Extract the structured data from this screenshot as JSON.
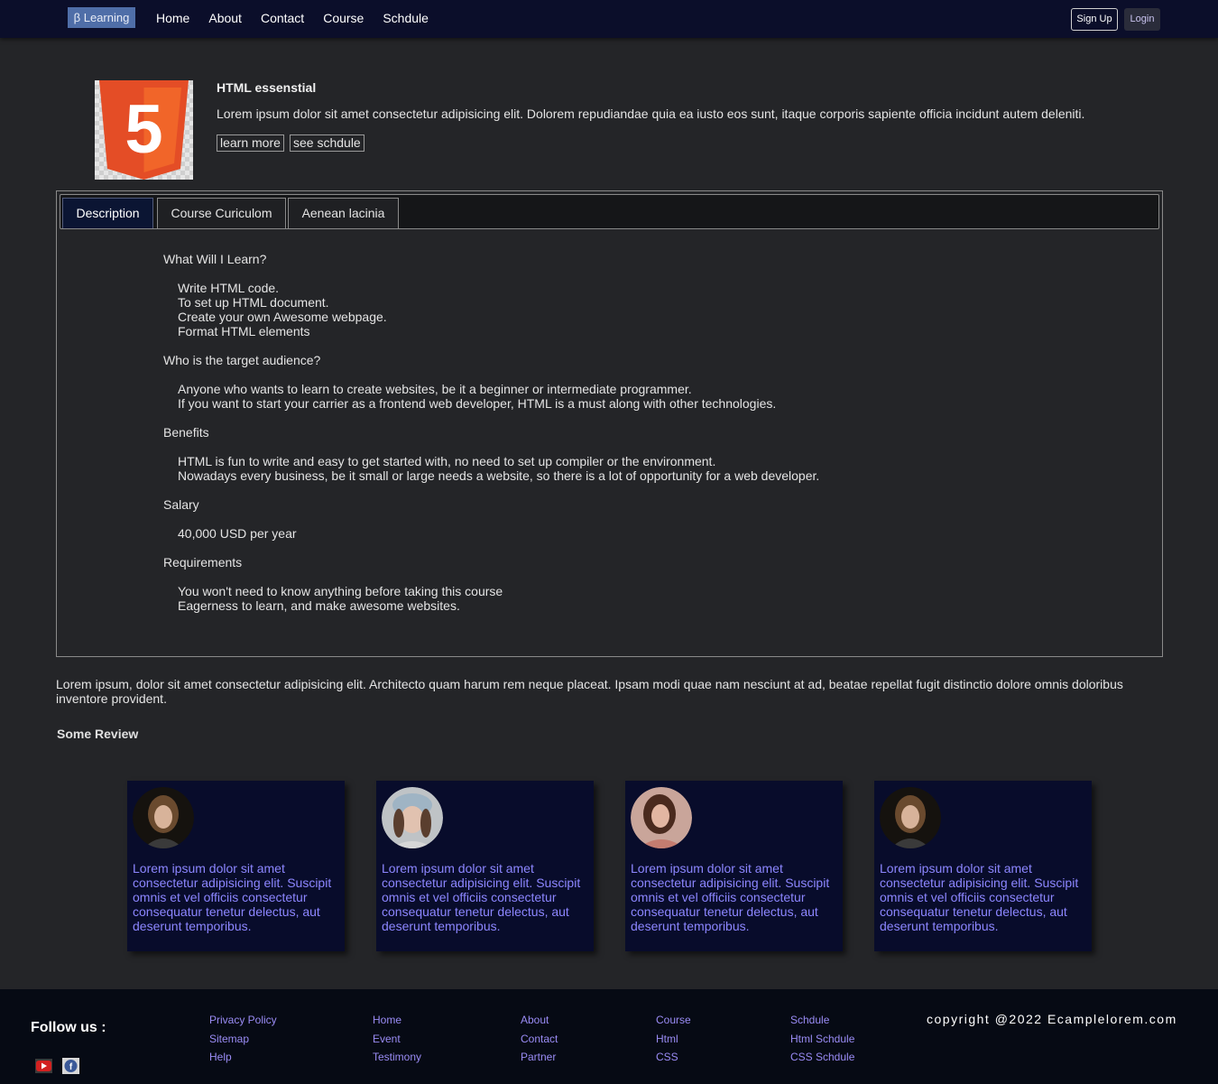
{
  "nav": {
    "brand": "β Learning",
    "links": [
      "Home",
      "About",
      "Contact",
      "Course",
      "Schdule"
    ],
    "signup": "Sign Up",
    "login": "Login"
  },
  "course": {
    "title": "HTML essenstial",
    "description": "Lorem ipsum dolor sit amet consectetur adipisicing elit. Dolorem repudiandae quia ea iusto eos sunt, itaque corporis sapiente officia incidunt autem deleniti.",
    "learn_more": "learn more",
    "see_schedule": "see schdule",
    "logo_digit": "5"
  },
  "tabs": [
    {
      "label": "Description"
    },
    {
      "label": "Course Curiculom"
    },
    {
      "label": "Aenean lacinia"
    }
  ],
  "description": {
    "sections": [
      {
        "question": "What Will I Learn?",
        "answers": [
          "Write HTML code.",
          "To set up HTML document.",
          "Create your own Awesome webpage.",
          "Format HTML elements"
        ]
      },
      {
        "question": "Who is the target audience?",
        "answers": [
          "Anyone who wants to learn to create websites, be it a beginner or intermediate programmer.",
          "If you want to start your carrier as a frontend web developer, HTML is a must along with other technologies."
        ]
      },
      {
        "question": "Benefits",
        "answers": [
          "HTML is fun to write and easy to get started with, no need to set up compiler or the environment.",
          "Nowadays every business, be it small or large needs a website, so there is a lot of opportunity for a web developer."
        ]
      },
      {
        "question": "Salary",
        "answers": [
          "40,000 USD per year"
        ]
      },
      {
        "question": "Requirements",
        "answers": [
          "You won't need to know anything before taking this course",
          "Eagerness to learn, and make awesome websites."
        ]
      }
    ]
  },
  "intro_paragraph": "Lorem ipsum, dolor sit amet consectetur adipisicing elit. Architecto quam harum rem neque placeat. Ipsam modi quae nam nesciunt at ad, beatae repellat fugit distinctio dolore omnis doloribus inventore provident.",
  "reviews": {
    "title": "Some Review",
    "items": [
      {
        "text": "Lorem ipsum dolor sit amet consectetur adipisicing elit. Suscipit omnis et vel officiis consectetur consequatur tenetur delectus, aut deserunt temporibus."
      },
      {
        "text": "Lorem ipsum dolor sit amet consectetur adipisicing elit. Suscipit omnis et vel officiis consectetur consequatur tenetur delectus, aut deserunt temporibus."
      },
      {
        "text": "Lorem ipsum dolor sit amet consectetur adipisicing elit. Suscipit omnis et vel officiis consectetur consequatur tenetur delectus, aut deserunt temporibus."
      },
      {
        "text": "Lorem ipsum dolor sit amet consectetur adipisicing elit. Suscipit omnis et vel officiis consectetur consequatur tenetur delectus, aut deserunt temporibus."
      }
    ]
  },
  "footer": {
    "follow": "Follow us :",
    "social_icons": [
      "youtube-icon",
      "facebook-icon"
    ],
    "columns": [
      [
        "Privacy Policy",
        "Sitemap",
        "Help"
      ],
      [
        "Home",
        "Event",
        "Testimony"
      ],
      [
        "About",
        "Contact",
        "Partner"
      ],
      [
        "Course",
        "Html",
        "CSS"
      ],
      [
        "Schdule",
        "Html Schdule",
        "CSS Schdule"
      ]
    ],
    "copyright": "copyright @2022 Ecamplelorem.com"
  },
  "colors": {
    "background": "#242528",
    "navbar": "#0b0e2a",
    "brand": "#4f6ea8",
    "card": "#080c2b",
    "card_text": "#8c86ff",
    "footer_link": "#9a8cf5",
    "html5_orange": "#e44d26"
  }
}
